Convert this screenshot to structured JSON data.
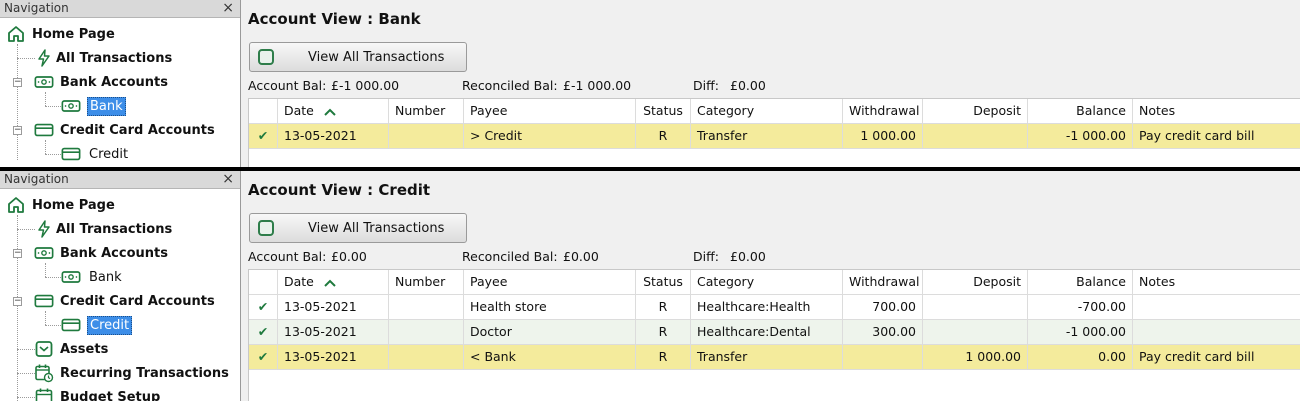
{
  "top": {
    "nav": {
      "header": "Navigation",
      "close": "×",
      "items": [
        {
          "label": "Home Page",
          "icon": "home-icon"
        },
        {
          "label": "All Transactions",
          "icon": "lightning-icon"
        },
        {
          "label": "Bank Accounts",
          "icon": "bank-note-icon"
        },
        {
          "label": "Bank",
          "icon": "bank-note-icon",
          "selected": true
        },
        {
          "label": "Credit Card Accounts",
          "icon": "credit-card-icon"
        },
        {
          "label": "Credit",
          "icon": "credit-card-icon"
        }
      ]
    },
    "title": "Account View : Bank",
    "view_button": "View All Transactions",
    "balances": {
      "account_label": "Account Bal:",
      "account_value": "£-1 000.00",
      "reconciled_label": "Reconciled Bal:",
      "reconciled_value": "£-1 000.00",
      "diff_label": "Diff:",
      "diff_value": "£0.00"
    },
    "columns": [
      "Date",
      "Number",
      "Payee",
      "Status",
      "Category",
      "Withdrawal",
      "Deposit",
      "Balance",
      "Notes"
    ],
    "rows": [
      {
        "check": "✔",
        "date": "13-05-2021",
        "number": "",
        "payee": "> Credit",
        "status": "R",
        "category": "Transfer",
        "withdrawal": "1 000.00",
        "deposit": "",
        "balance": "-1 000.00",
        "notes": "Pay credit card bill",
        "style": "yellow"
      }
    ]
  },
  "bottom": {
    "nav": {
      "header": "Navigation",
      "close": "×",
      "items": [
        {
          "label": "Home Page",
          "icon": "home-icon"
        },
        {
          "label": "All Transactions",
          "icon": "lightning-icon"
        },
        {
          "label": "Bank Accounts",
          "icon": "bank-note-icon"
        },
        {
          "label": "Bank",
          "icon": "bank-note-icon"
        },
        {
          "label": "Credit Card Accounts",
          "icon": "credit-card-icon"
        },
        {
          "label": "Credit",
          "icon": "credit-card-icon",
          "selected": true
        },
        {
          "label": "Assets",
          "icon": "assets-icon"
        },
        {
          "label": "Recurring Transactions",
          "icon": "calendar-clock-icon"
        },
        {
          "label": "Budget Setup",
          "icon": "calendar-icon"
        }
      ]
    },
    "title": "Account View : Credit",
    "view_button": "View All Transactions",
    "balances": {
      "account_label": "Account Bal:",
      "account_value": "£0.00",
      "reconciled_label": "Reconciled Bal:",
      "reconciled_value": "£0.00",
      "diff_label": "Diff:",
      "diff_value": "£0.00"
    },
    "columns": [
      "Date",
      "Number",
      "Payee",
      "Status",
      "Category",
      "Withdrawal",
      "Deposit",
      "Balance",
      "Notes"
    ],
    "rows": [
      {
        "check": "✔",
        "date": "13-05-2021",
        "number": "",
        "payee": "Health store",
        "status": "R",
        "category": "Healthcare:Health",
        "withdrawal": "700.00",
        "deposit": "",
        "balance": "-700.00",
        "notes": "",
        "style": "white"
      },
      {
        "check": "✔",
        "date": "13-05-2021",
        "number": "",
        "payee": "Doctor",
        "status": "R",
        "category": "Healthcare:Dental",
        "withdrawal": "300.00",
        "deposit": "",
        "balance": "-1 000.00",
        "notes": "",
        "style": "alt"
      },
      {
        "check": "✔",
        "date": "13-05-2021",
        "number": "",
        "payee": "< Bank",
        "status": "R",
        "category": "Transfer",
        "withdrawal": "",
        "deposit": "1 000.00",
        "balance": "0.00",
        "notes": "Pay credit card bill",
        "style": "yellow"
      }
    ]
  },
  "colors": {
    "accent": "#1f7a3e",
    "selection": "#3d8ee8",
    "highlight_row": "#f4eb9c"
  }
}
